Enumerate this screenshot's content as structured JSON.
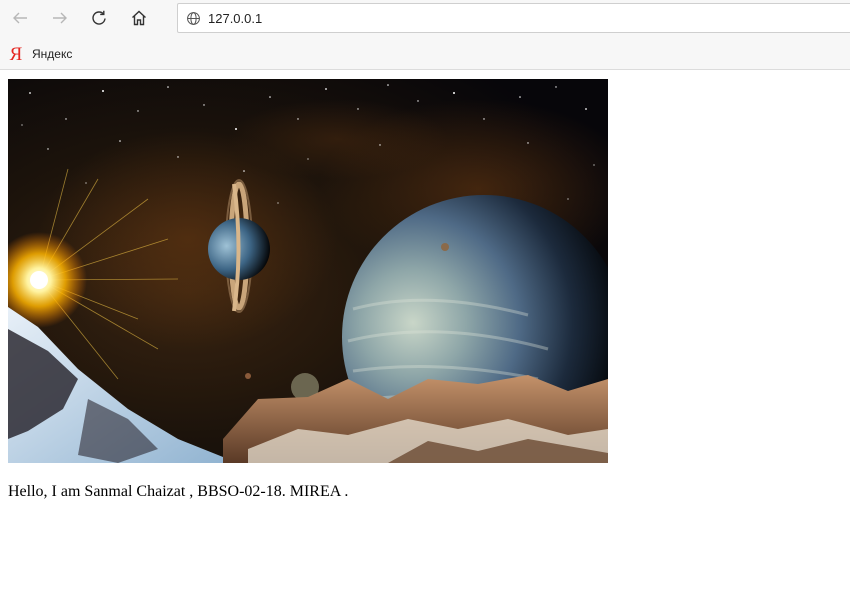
{
  "browser": {
    "address_bar": {
      "url": "127.0.0.1",
      "icon": "globe-icon"
    },
    "nav": {
      "back_icon": "back-arrow-icon",
      "forward_icon": "forward-arrow-icon",
      "reload_icon": "reload-icon",
      "home_icon": "home-icon"
    },
    "bookmarks": [
      {
        "icon_glyph": "Я",
        "label": "Яндекс",
        "icon_color": "#e52620"
      }
    ]
  },
  "page": {
    "image": {
      "subject": "space-scene",
      "icon": "space-picture"
    },
    "greeting": "Hello, I am Sanmal Chaizat , BBSO-02-18. MIREA ."
  }
}
